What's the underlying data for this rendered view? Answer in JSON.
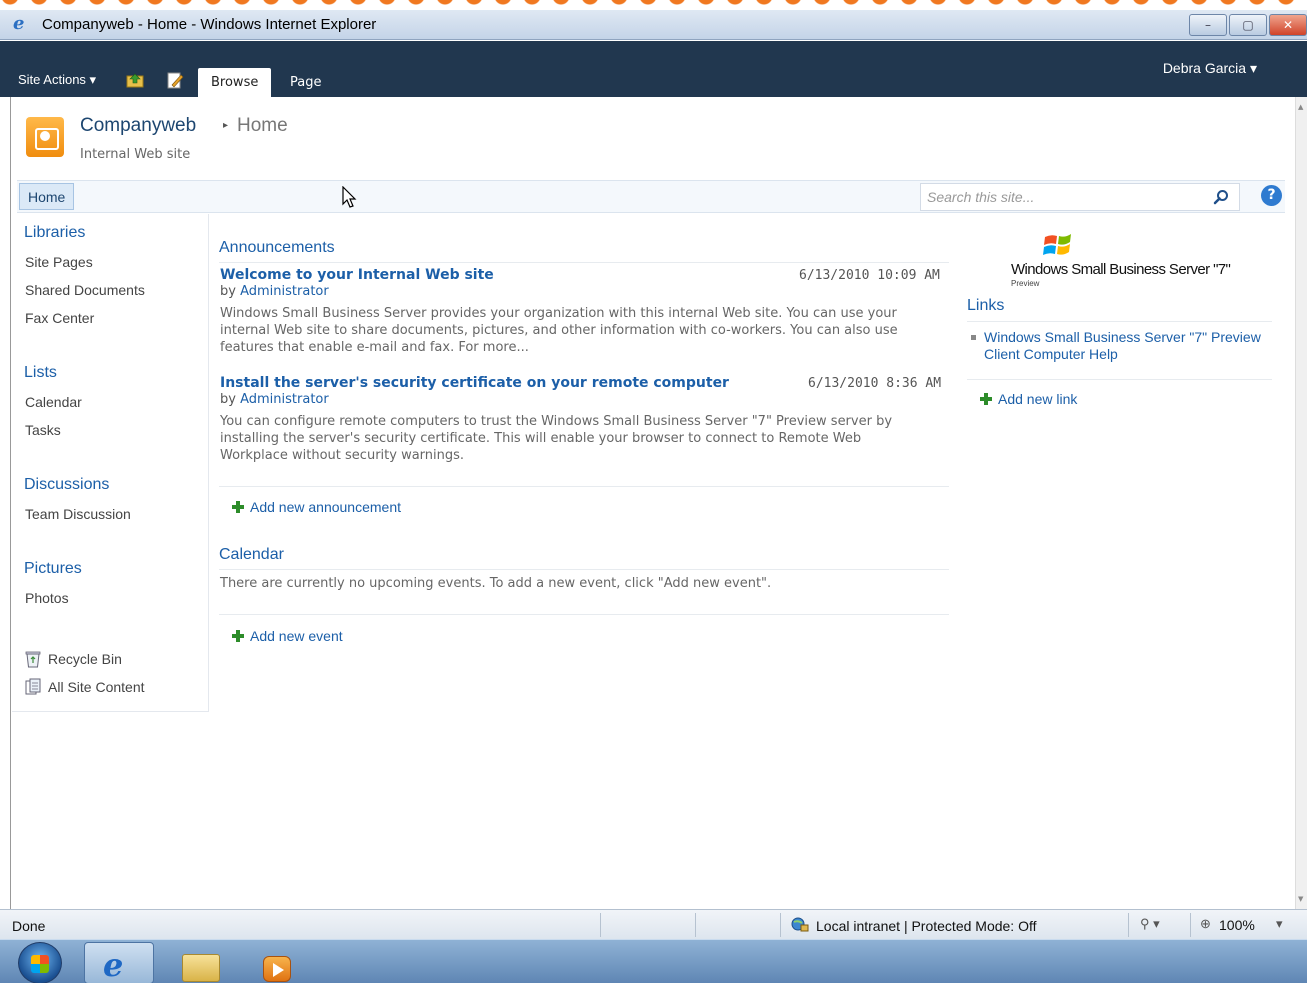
{
  "window": {
    "title": "Companyweb - Home - Windows Internet Explorer",
    "controls": [
      "–",
      "▢",
      "✕"
    ]
  },
  "ribbon": {
    "site_actions": "Site Actions",
    "tabs": [
      "Browse",
      "Page"
    ],
    "user": "Debra Garcia"
  },
  "header": {
    "site_title": "Companyweb",
    "page_title": "Home",
    "description": "Internal Web site"
  },
  "topnav": {
    "home": "Home",
    "search_placeholder": "Search this site..."
  },
  "quicklaunch": {
    "libraries": {
      "heading": "Libraries",
      "items": [
        "Site Pages",
        "Shared Documents",
        "Fax Center"
      ]
    },
    "lists": {
      "heading": "Lists",
      "items": [
        "Calendar",
        "Tasks"
      ]
    },
    "discussions": {
      "heading": "Discussions",
      "items": [
        "Team Discussion"
      ]
    },
    "pictures": {
      "heading": "Pictures",
      "items": [
        "Photos"
      ]
    },
    "recycle_bin": "Recycle Bin",
    "all_site_content": "All Site Content"
  },
  "announcements": {
    "title": "Announcements",
    "items": [
      {
        "title": "Welcome to your Internal Web site",
        "date": "6/13/2010 10:09 AM",
        "by_prefix": "by",
        "author": "Administrator",
        "body": "Windows Small Business Server provides your organization with this internal Web site. You can use your internal Web site to share documents, pictures, and other information with co-workers. You can also use features that enable e-mail and fax. For more..."
      },
      {
        "title": "Install the server's security certificate on your remote computer",
        "date": "6/13/2010 8:36 AM",
        "by_prefix": "by",
        "author": "Administrator",
        "body": "You can configure remote computers to trust the Windows Small Business Server \"7\" Preview server by installing the server's security certificate. This will enable your browser to connect to Remote Web Workplace without security warnings."
      }
    ],
    "add_label": "Add new announcement"
  },
  "calendar": {
    "title": "Calendar",
    "empty_text": "There are currently no upcoming events. To add a new event, click \"Add new event\".",
    "add_label": "Add new event"
  },
  "sidebar": {
    "logo_name": "Windows Small Business Server \"7\"",
    "logo_sub": "Preview",
    "links_title": "Links",
    "links": [
      "Windows Small Business Server \"7\" Preview Client Computer Help"
    ],
    "add_link_label": "Add new link"
  },
  "statusbar": {
    "status": "Done",
    "zone": "Local intranet | Protected Mode: Off",
    "zoom": "100%"
  },
  "colors": {
    "ribbon_bg": "#21374f",
    "link_blue": "#1c5fa8",
    "accent_orange": "#f08d0f"
  }
}
